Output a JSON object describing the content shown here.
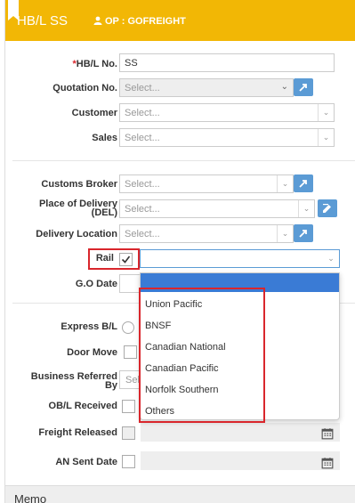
{
  "header": {
    "title": "HB/L SS",
    "op_label": "OP : GOFREIGHT"
  },
  "form": {
    "hbl_no": {
      "label": "HB/L No.",
      "required_mark": "*",
      "value": "SS"
    },
    "quotation_no": {
      "label": "Quotation No.",
      "placeholder": "Select..."
    },
    "customer": {
      "label": "Customer",
      "placeholder": "Select..."
    },
    "sales": {
      "label": "Sales",
      "placeholder": "Select..."
    },
    "customs_broker": {
      "label": "Customs Broker",
      "placeholder": "Select..."
    },
    "place_of_delivery": {
      "label_line1": "Place of Delivery",
      "label_line2": "(DEL)",
      "placeholder": "Select..."
    },
    "delivery_location": {
      "label": "Delivery Location",
      "placeholder": "Select..."
    },
    "rail": {
      "label": "Rail",
      "checked": true,
      "value": ""
    },
    "go_date": {
      "label": "G.O Date"
    },
    "express_bl": {
      "label": "Express B/L"
    },
    "door_move": {
      "label": "Door Move"
    },
    "business_referred_by": {
      "label_line1": "Business Referred",
      "label_line2": "By",
      "placeholder": "Sel"
    },
    "obl_received": {
      "label": "OB/L Received"
    },
    "freight_released": {
      "label": "Freight Released"
    },
    "an_sent_date": {
      "label": "AN Sent Date"
    }
  },
  "rail_dropdown": {
    "options": [
      "Union Pacific",
      "BNSF",
      "Canadian National",
      "Canadian Pacific",
      "Norfolk Southern",
      "Others"
    ]
  },
  "memo": {
    "label": "Memo"
  },
  "colors": {
    "header_bg": "#f2b705",
    "accent_blue": "#5b9bd5",
    "highlight_red": "#d9262c",
    "dropdown_highlight": "#3a7bd5"
  }
}
